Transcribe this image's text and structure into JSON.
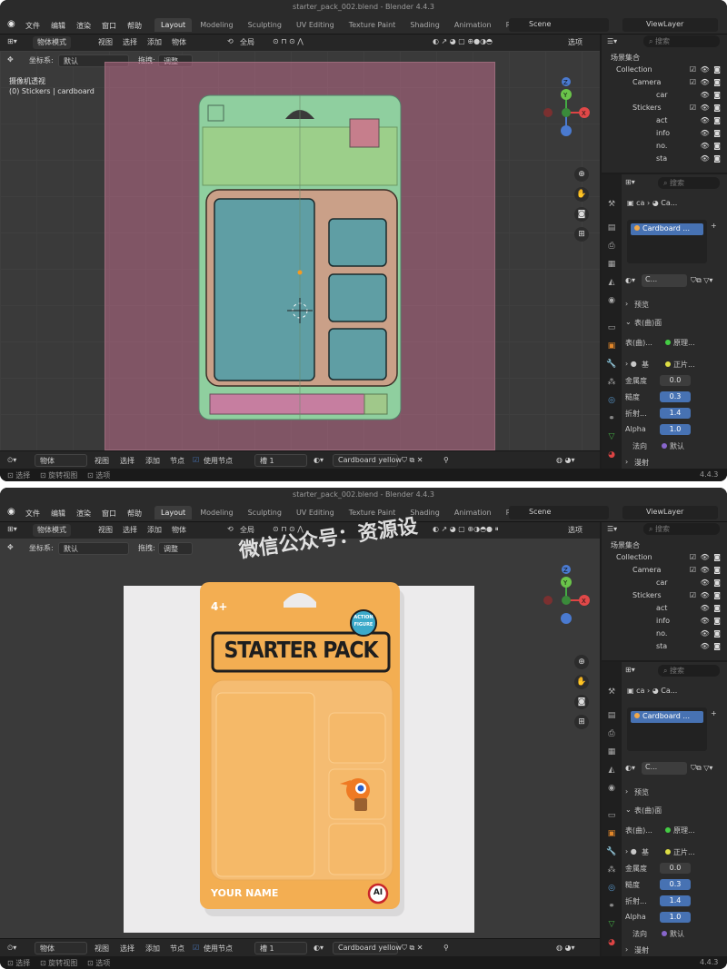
{
  "app": {
    "window_title": "starter_pack_002.blend - Blender 4.4.3",
    "menu": [
      "文件",
      "编辑",
      "渲染",
      "窗口",
      "帮助"
    ],
    "workspace_tabs": [
      "Layout",
      "Modeling",
      "Sculpting",
      "UV Editing",
      "Texture Paint",
      "Shading",
      "Animation",
      "Render"
    ],
    "scene": "Scene",
    "view_layer": "ViewLayer"
  },
  "viewport_header": {
    "mode": "物体模式",
    "menus": [
      "视图",
      "选择",
      "添加",
      "物体"
    ],
    "transform": "全局",
    "options": "选项"
  },
  "tool_settings": {
    "coord_label": "坐标系:",
    "coord_value": "默认",
    "drag_label": "拖拽:",
    "drag_value": "调整"
  },
  "viewport1": {
    "overlay_line1": "摄像机透视",
    "overlay_line2": "(0) Stickers | cardboard"
  },
  "footer": {
    "editor": "物体",
    "menus": [
      "视图",
      "选择",
      "添加",
      "节点"
    ],
    "use_nodes": "使用节点",
    "slot": "槽 1",
    "material": "Cardboard yellow"
  },
  "statusbar": {
    "select": "选择",
    "rotate": "旋转视图",
    "menu": "选项",
    "version": "4.4.3"
  },
  "outliner": {
    "search_placeholder": "搜索",
    "root": "场景集合",
    "rows": [
      {
        "label": "Collection",
        "indent": 1
      },
      {
        "label": "Camera",
        "indent": 2
      },
      {
        "label": "car",
        "indent": 3
      },
      {
        "label": "Stickers",
        "indent": 2
      },
      {
        "label": "act",
        "indent": 3
      },
      {
        "label": "info",
        "indent": 3
      },
      {
        "label": "no.",
        "indent": 3
      },
      {
        "label": "sta",
        "indent": 3
      }
    ]
  },
  "properties": {
    "breadcrumb_obj": "ca",
    "breadcrumb_mat": "Ca...",
    "material_slot": "Cardboard ...",
    "material_short": "C...",
    "preview": "预览",
    "surface": "表(曲)面",
    "surface_label": "表(曲)...",
    "surface_value": "原理...",
    "base_label": "基",
    "base_value": "正片...",
    "fields": [
      {
        "k": "金属度",
        "v": "0.0",
        "hl": false
      },
      {
        "k": "糙度",
        "v": "0.3",
        "hl": true
      },
      {
        "k": "折射...",
        "v": "1.4",
        "hl": true
      },
      {
        "k": "Alpha",
        "v": "1.0",
        "hl": true
      }
    ],
    "normal_label": "法向",
    "normal_value": "默认",
    "subsurface": "漫射"
  },
  "render": {
    "top_text": "4+",
    "badge_line1": "ACTION",
    "badge_line2": "FIGURE",
    "title": "STARTER PACK",
    "bottom_text": "YOUR NAME",
    "logo_text": "AI"
  },
  "watermark": "微信公众号：资源设",
  "colors": {
    "bg": "#1d1d1d",
    "panel": "#2a2a2a",
    "accent_blue": "#4772b3",
    "card_orange": "#f3ae52",
    "card_green": "#8fcf9f",
    "blister_teal": "#5f9ea4"
  }
}
